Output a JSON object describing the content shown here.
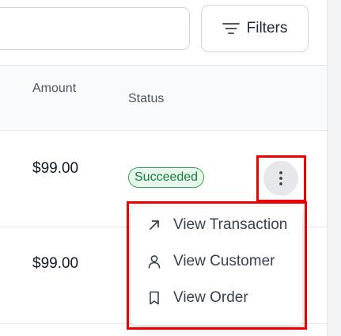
{
  "toolbar": {
    "filters_label": "Filters",
    "filters_icon": "filter-lines-icon"
  },
  "table": {
    "columns": [
      {
        "label": "Amount"
      },
      {
        "label": "Status"
      }
    ],
    "rows": [
      {
        "amount": "$99.00",
        "status": "Succeeded"
      },
      {
        "amount": "$99.00"
      }
    ]
  },
  "row_actions": {
    "kebab_icon": "dots-vertical-icon",
    "menu": [
      {
        "label": "View Transaction",
        "icon": "arrow-up-right-icon"
      },
      {
        "label": "View Customer",
        "icon": "user-icon"
      },
      {
        "label": "View Order",
        "icon": "bookmark-icon"
      }
    ]
  },
  "colors": {
    "highlight": "#ee0000",
    "success_text": "#15803d",
    "success_border": "#34a853",
    "success_bg": "#e8f7ec"
  }
}
